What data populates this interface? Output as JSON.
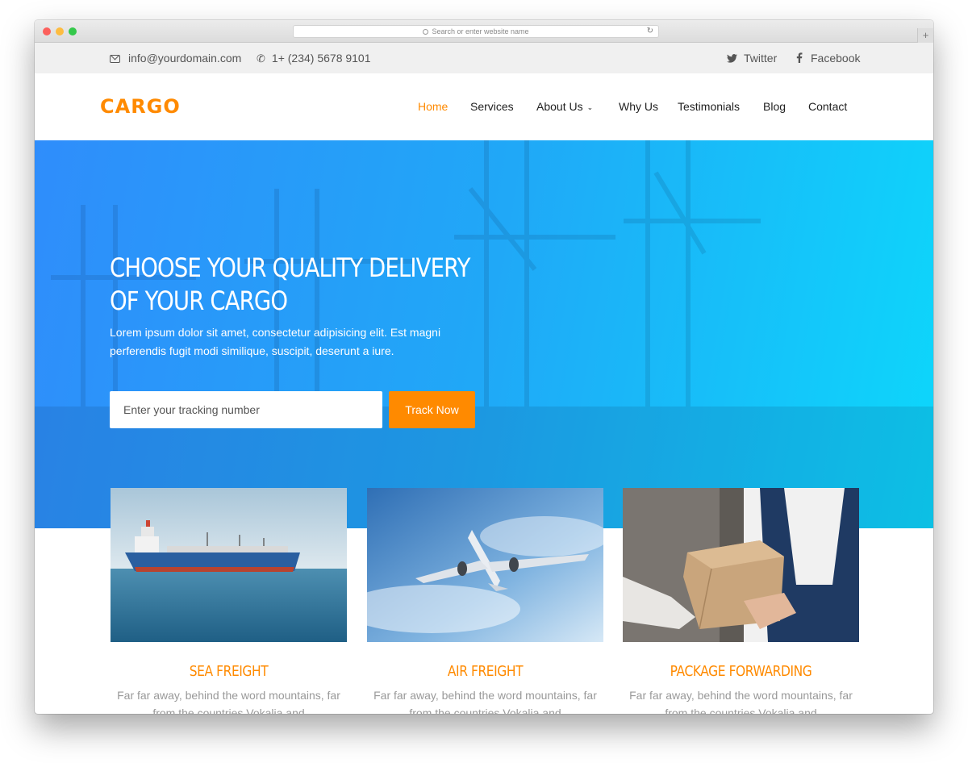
{
  "browser": {
    "address_placeholder": "Search or enter website name"
  },
  "topbar": {
    "email": "info@yourdomain.com",
    "phone": "1+ (234) 5678 9101",
    "twitter": "Twitter",
    "facebook": "Facebook"
  },
  "brand": {
    "logo": "CARGO",
    "accent": "#ff8a00",
    "hero_gradient": [
      "#2f8dfb",
      "#0dd7fb"
    ]
  },
  "nav": {
    "items": [
      {
        "label": "Home",
        "active": true
      },
      {
        "label": "Services"
      },
      {
        "label": "About Us",
        "dropdown": true
      },
      {
        "label": "Why Us"
      },
      {
        "label": "Testimonials"
      },
      {
        "label": "Blog"
      },
      {
        "label": "Contact"
      }
    ]
  },
  "hero": {
    "title_line1": "CHOOSE YOUR QUALITY DELIVERY",
    "title_line2": "OF YOUR CARGO",
    "subtitle": "Lorem ipsum dolor sit amet, consectetur adipisicing elit. Est magni perferendis fugit modi similique, suscipit, deserunt a iure.",
    "tracking_placeholder": "Enter your tracking number",
    "track_button": "Track Now"
  },
  "services": [
    {
      "title": "SEA FREIGHT",
      "text": "Far far away, behind the word mountains, far from the countries Vokalia and"
    },
    {
      "title": "AIR FREIGHT",
      "text": "Far far away, behind the word mountains, far from the countries Vokalia and"
    },
    {
      "title": "PACKAGE FORWARDING",
      "text": "Far far away, behind the word mountains, far from the countries Vokalia and"
    }
  ]
}
